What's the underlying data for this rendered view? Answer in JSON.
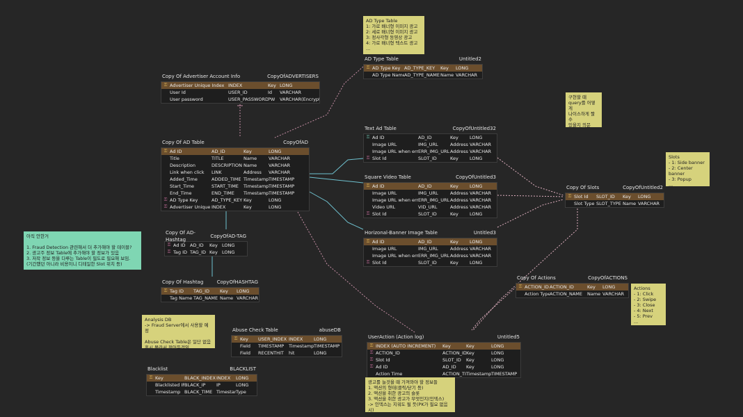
{
  "tables": {
    "advertisers": {
      "logical": "Copy Of Advertiser Account Info",
      "physical": "CopyOfADVERTISERS",
      "rows": [
        {
          "k": "pk",
          "a": "Advertiser Unique Index",
          "b": "INDEX",
          "c": "Key",
          "d": "LONG"
        },
        {
          "k": "",
          "a": "User Id",
          "b": "USER_ID",
          "c": "Id",
          "d": "VARCHAR"
        },
        {
          "k": "",
          "a": "User password",
          "b": "USER_PASSWORD",
          "c": "PW",
          "d": "VARCHAR(Encrypted)"
        }
      ]
    },
    "ad": {
      "logical": "Copy Of AD Table",
      "physical": "CopyOfAD",
      "rows": [
        {
          "k": "pk",
          "a": "Ad ID",
          "b": "AD_ID",
          "c": "Key",
          "d": "LONG"
        },
        {
          "k": "",
          "a": "Title",
          "b": "TITLE",
          "c": "Name",
          "d": "VARCHAR"
        },
        {
          "k": "",
          "a": "Description",
          "b": "DESCRIPTION",
          "c": "Name",
          "d": "VARCHAR"
        },
        {
          "k": "",
          "a": "Link when click",
          "b": "LINK",
          "c": "Address",
          "d": "VARCHAR"
        },
        {
          "k": "",
          "a": "Added_Time",
          "b": "ADDED_TIME",
          "c": "Timestamp",
          "d": "TIMESTAMP"
        },
        {
          "k": "",
          "a": "Start_Time",
          "b": "START_TIME",
          "c": "Timestamp",
          "d": "TIMESTAMP"
        },
        {
          "k": "",
          "a": "End_Time",
          "b": "END_TIME",
          "c": "Timestamp",
          "d": "TIMESTAMP"
        },
        {
          "k": "fk",
          "a": "AD Type Key",
          "b": "AD_TYPE_KEY",
          "c": "Key",
          "d": "LONG"
        },
        {
          "k": "fk",
          "a": "Advertiser Unique Index",
          "b": "INDEX",
          "c": "Key",
          "d": "LONG"
        }
      ]
    },
    "adtype": {
      "logical": "AD Type Table",
      "physical": "Untitled2",
      "rows": [
        {
          "k": "pk",
          "a": "AD Type Key",
          "b": "AD_TYPE_KEY",
          "c": "Key",
          "d": "LONG"
        },
        {
          "k": "",
          "a": "AD Type Name",
          "b": "AD_TYPE_NAME",
          "c": "Name",
          "d": "VARCHAR"
        }
      ]
    },
    "textad": {
      "logical": "Text Ad Table",
      "physical": "CopyOfUntitled32",
      "rows": [
        {
          "k": "ak",
          "a": "Ad ID",
          "b": "AD_ID",
          "c": "Key",
          "d": "LONG"
        },
        {
          "k": "",
          "a": "Image URL",
          "b": "IMG_URL",
          "c": "Address",
          "d": "VARCHAR"
        },
        {
          "k": "",
          "a": "Image URL when error",
          "b": "ERR_IMG_URL",
          "c": "Address",
          "d": "VARCHAR"
        },
        {
          "k": "fk",
          "a": "Slot Id",
          "b": "SLOT_ID",
          "c": "Key",
          "d": "LONG"
        }
      ]
    },
    "squarevideo": {
      "logical": "Square Video Table",
      "physical": "CopyOfUntitled3",
      "rows": [
        {
          "k": "pk",
          "a": "Ad ID",
          "b": "AD_ID",
          "c": "Key",
          "d": "LONG"
        },
        {
          "k": "",
          "a": "Image URL",
          "b": "IMG_URL",
          "c": "Address",
          "d": "VARCHAR"
        },
        {
          "k": "",
          "a": "Image URL when error",
          "b": "ERR_IMG_URL",
          "c": "Address",
          "d": "VARCHAR"
        },
        {
          "k": "",
          "a": "Video URL",
          "b": "VID_URL",
          "c": "Address",
          "d": "VARCHAR"
        },
        {
          "k": "fk",
          "a": "Slot Id",
          "b": "SLOT_ID",
          "c": "Key",
          "d": "LONG"
        }
      ]
    },
    "banner": {
      "logical": "Horizonal-Banner Image Table",
      "physical": "Untitled3",
      "rows": [
        {
          "k": "pk",
          "a": "Ad ID",
          "b": "AD_ID",
          "c": "Key",
          "d": "LONG"
        },
        {
          "k": "",
          "a": "Image URL",
          "b": "IMG_URL",
          "c": "Address",
          "d": "VARCHAR"
        },
        {
          "k": "",
          "a": "Image URL when error",
          "b": "ERR_IMG_URL",
          "c": "Address",
          "d": "VARCHAR"
        },
        {
          "k": "fk",
          "a": "Slot Id",
          "b": "SLOT_ID",
          "c": "Key",
          "d": "LONG"
        }
      ]
    },
    "slots": {
      "logical": "Copy Of Slots",
      "physical": "CopyOfUntitled2",
      "rows": [
        {
          "k": "pk",
          "a": "Slot Id",
          "b": "SLOT_ID",
          "c": "Key",
          "d": "LONG"
        },
        {
          "k": "",
          "a": "Slot Type",
          "b": "SLOT_TYPE",
          "c": "Name",
          "d": "VARCHAR"
        }
      ]
    },
    "adtag": {
      "logical": "Copy Of AD-Hashtag",
      "physical": "CopyOfAD-TAG",
      "rows": [
        {
          "k": "fk",
          "a": "Ad ID",
          "b": "AD_ID",
          "c": "Key",
          "d": "LONG"
        },
        {
          "k": "fk",
          "a": "Tag ID",
          "b": "TAG_ID",
          "c": "Key",
          "d": "LONG"
        }
      ]
    },
    "hashtag": {
      "logical": "Copy Of Hashtag",
      "physical": "CopyOfHASHTAG",
      "rows": [
        {
          "k": "pk",
          "a": "Tag ID",
          "b": "TAG_ID",
          "c": "Key",
          "d": "LONG"
        },
        {
          "k": "",
          "a": "Tag Name",
          "b": "TAG_NAME",
          "c": "Name",
          "d": "VARCHAR"
        }
      ]
    },
    "actions": {
      "logical": "Copy Of Actions",
      "physical": "CopyOfACTIONS",
      "rows": [
        {
          "k": "pk",
          "a": "ACTION_ID",
          "b": "ACTION_ID",
          "c": "Key",
          "d": "LONG"
        },
        {
          "k": "",
          "a": "Action Type",
          "b": "ACTION_NAME",
          "c": "Name",
          "d": "VARCHAR"
        }
      ]
    },
    "useraction": {
      "logical": "UserAction (Action log)",
      "physical": "Untitled5",
      "rows": [
        {
          "k": "pk",
          "a": "INDEX (AUTO INCREMENT)",
          "b": "Key",
          "c": "Key",
          "d": "LONG"
        },
        {
          "k": "fk",
          "a": "ACTION_ID",
          "b": "ACTION_ID",
          "c": "Key",
          "d": "LONG"
        },
        {
          "k": "fk",
          "a": "Slot Id",
          "b": "SLOT_ID",
          "c": "Key",
          "d": "LONG"
        },
        {
          "k": "fk",
          "a": "Ad ID",
          "b": "AD_ID",
          "c": "Key",
          "d": "LONG"
        },
        {
          "k": "",
          "a": "Action Time",
          "b": "ACTION_TIME",
          "c": "Timestamp",
          "d": "TIMESTAMP"
        }
      ]
    },
    "abuse": {
      "logical": "Abuse Check Table",
      "physical": "abuseDB",
      "rows": [
        {
          "k": "pk",
          "a": "Key",
          "b": "USER_INDEX",
          "c": "INDEX",
          "d": "LONG"
        },
        {
          "k": "",
          "a": "Field",
          "b": "TIMESTAMP",
          "c": "Timestamp",
          "d": "TIMESTAMP"
        },
        {
          "k": "",
          "a": "Field",
          "b": "RECENTHIT",
          "c": "hit",
          "d": "LONG"
        }
      ]
    },
    "blacklist": {
      "logical": "Blacklist",
      "physical": "BLACKLIST",
      "rows": [
        {
          "k": "pk",
          "a": "Key",
          "b": "BLACK_INDEX",
          "c": "INDEX",
          "d": "LONG"
        },
        {
          "k": "",
          "a": "Blacklisted IP",
          "b": "BLACK_IP",
          "c": "IP",
          "d": "LONG"
        },
        {
          "k": "",
          "a": "Timestamp",
          "b": "BLACK_TIME",
          "c": "Timestamp",
          "d": "Type"
        }
      ]
    }
  },
  "notes": {
    "adtype": "AD Type Table\n1: 가로 배너형 이미지 광고\n2: 세로 배너형 이미지 광고\n3: 정사각형 동영상 광고\n4: 가로 배너형 텍스트 광고\n...",
    "query": "구현할 때\nquery를 어떻게\n나이스하게 짤 수\n있을지 의문",
    "slots": "Slots\n- 1: Side banner\n- 2: Center banner\n- 3: Popup\n...",
    "todo": "아직 안한거\n\n1. Fraud Detection 관련해서 더 추가해야 할 테이블?\n2. 광고주 정보 Table에 추가해야 할 정보가 있음\n3. 저작 정보 등을 다루는 Table이 필도로 필요해 보임.\n(기간했던 아니라 비용이니 디테일한 Slot 위치 등)",
    "actions": "Actions\n- 1: Click\n- 2: Swipe\n- 3: Close\n- 4: Next\n- 5: Prev\n...",
    "analysis": "Analysis DB\n-> Fraud Server에서 사용할 예정\n\nAbuse Check Table은 일단 없음\n혹시 몰라서 적어둔것임",
    "bottom": "광고를 늘것을 때 가져와야 할 정보들\n1. 액션의 형태(클릭/닫기 등)\n2. 액션을 취한 광고의 슬롯\n3. 액션을 취한 광고가 무엇인지(인덱스)\n-> 인덱스는 지워도 될 듯(PK가 필요 없음 시)"
  }
}
